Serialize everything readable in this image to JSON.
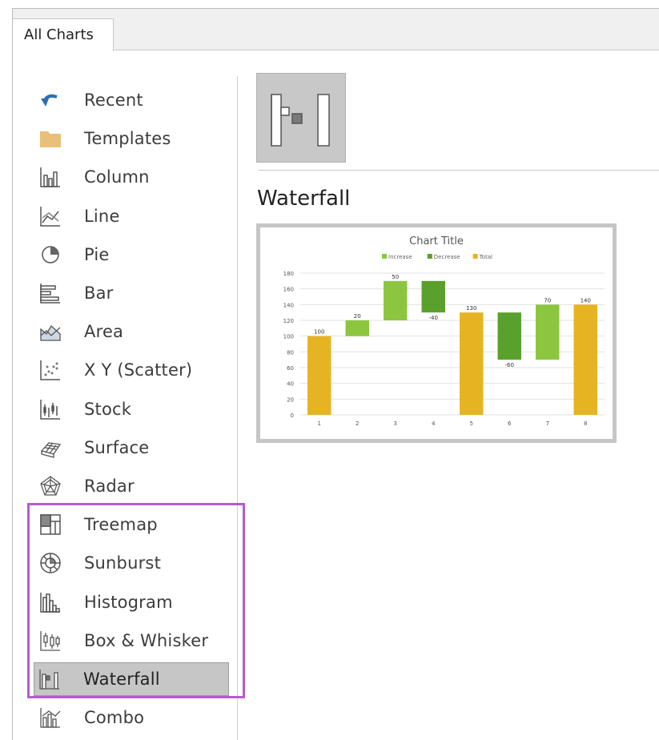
{
  "tab": {
    "label": "All Charts"
  },
  "sidebar": {
    "items": [
      {
        "label": "Recent",
        "icon": "undo-arrow-icon"
      },
      {
        "label": "Templates",
        "icon": "folder-icon"
      },
      {
        "label": "Column",
        "icon": "column-chart-icon"
      },
      {
        "label": "Line",
        "icon": "line-chart-icon"
      },
      {
        "label": "Pie",
        "icon": "pie-chart-icon"
      },
      {
        "label": "Bar",
        "icon": "bar-chart-icon"
      },
      {
        "label": "Area",
        "icon": "area-chart-icon"
      },
      {
        "label": "X Y (Scatter)",
        "icon": "scatter-chart-icon"
      },
      {
        "label": "Stock",
        "icon": "stock-chart-icon"
      },
      {
        "label": "Surface",
        "icon": "surface-chart-icon"
      },
      {
        "label": "Radar",
        "icon": "radar-chart-icon"
      },
      {
        "label": "Treemap",
        "icon": "treemap-chart-icon"
      },
      {
        "label": "Sunburst",
        "icon": "sunburst-chart-icon"
      },
      {
        "label": "Histogram",
        "icon": "histogram-chart-icon"
      },
      {
        "label": "Box & Whisker",
        "icon": "box-whisker-chart-icon"
      },
      {
        "label": "Waterfall",
        "icon": "waterfall-chart-icon",
        "selected": true
      },
      {
        "label": "Combo",
        "icon": "combo-chart-icon"
      }
    ],
    "highlight_color": "#b35bd4"
  },
  "main": {
    "selected_type": "Waterfall",
    "thumbnail_icon": "waterfall-chart-icon"
  },
  "chart_data": {
    "type": "bar",
    "title": "Chart Title",
    "legend": [
      "Increase",
      "Decrease",
      "Total"
    ],
    "legend_position": "top",
    "categories": [
      "1",
      "2",
      "3",
      "4",
      "5",
      "6",
      "7",
      "8"
    ],
    "ylim": [
      0,
      180
    ],
    "yticks": [
      0,
      20,
      40,
      60,
      80,
      100,
      120,
      140,
      160,
      180
    ],
    "bars": [
      {
        "kind": "total",
        "start": 0,
        "end": 100,
        "label": "100"
      },
      {
        "kind": "increase",
        "start": 100,
        "end": 120,
        "label": "20"
      },
      {
        "kind": "increase",
        "start": 120,
        "end": 170,
        "label": "50"
      },
      {
        "kind": "decrease",
        "start": 170,
        "end": 130,
        "label": "-40"
      },
      {
        "kind": "total",
        "start": 0,
        "end": 130,
        "label": "130"
      },
      {
        "kind": "decrease",
        "start": 130,
        "end": 70,
        "label": "-60"
      },
      {
        "kind": "increase",
        "start": 70,
        "end": 140,
        "label": "70"
      },
      {
        "kind": "total",
        "start": 0,
        "end": 140,
        "label": "140"
      }
    ],
    "colors": {
      "increase": "#8cc63f",
      "decrease": "#5aa02c",
      "total": "#e6b422"
    },
    "grid": true
  }
}
